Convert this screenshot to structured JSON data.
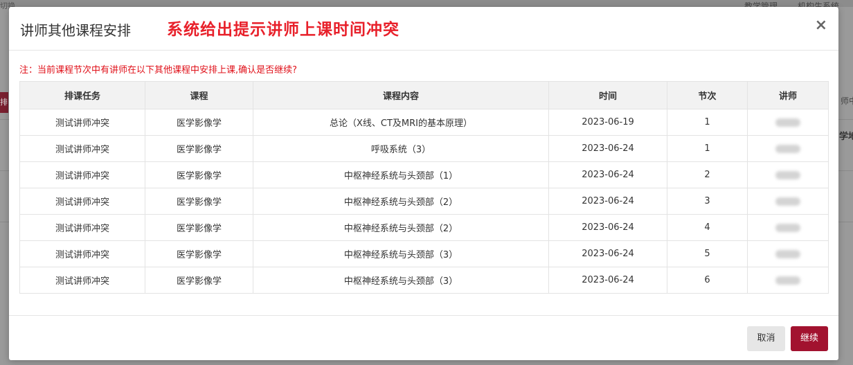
{
  "background": {
    "top_left": "切换",
    "top_right": [
      "教学管理",
      "机构生系统"
    ],
    "left_button": "排",
    "right_fragment_1": "师中",
    "right_fragment_2": "学地"
  },
  "modal": {
    "title": "讲师其他课程安排",
    "overlay_note": "系统给出提示讲师上课时间冲突",
    "close_icon": "×",
    "warning": "注：当前课程节次中有讲师在以下其他课程中安排上课,确认是否继续?",
    "columns": [
      "排课任务",
      "课程",
      "课程内容",
      "时间",
      "节次",
      "讲师"
    ],
    "rows": [
      {
        "task": "测试讲师冲突",
        "course": "医学影像学",
        "content": "总论（X线、CT及MRI的基本原理）",
        "date": "2023-06-19",
        "period": "1"
      },
      {
        "task": "测试讲师冲突",
        "course": "医学影像学",
        "content": "呼吸系统（3）",
        "date": "2023-06-24",
        "period": "1"
      },
      {
        "task": "测试讲师冲突",
        "course": "医学影像学",
        "content": "中枢神经系统与头颈部（1）",
        "date": "2023-06-24",
        "period": "2"
      },
      {
        "task": "测试讲师冲突",
        "course": "医学影像学",
        "content": "中枢神经系统与头颈部（2）",
        "date": "2023-06-24",
        "period": "3"
      },
      {
        "task": "测试讲师冲突",
        "course": "医学影像学",
        "content": "中枢神经系统与头颈部（2）",
        "date": "2023-06-24",
        "period": "4"
      },
      {
        "task": "测试讲师冲突",
        "course": "医学影像学",
        "content": "中枢神经系统与头颈部（3）",
        "date": "2023-06-24",
        "period": "5"
      },
      {
        "task": "测试讲师冲突",
        "course": "医学影像学",
        "content": "中枢神经系统与头颈部（3）",
        "date": "2023-06-24",
        "period": "6"
      }
    ],
    "buttons": {
      "cancel": "取消",
      "continue": "继续"
    },
    "colors": {
      "accent": "#a2122f",
      "warning": "#e0111a",
      "overlay_note": "#e8202a"
    }
  }
}
